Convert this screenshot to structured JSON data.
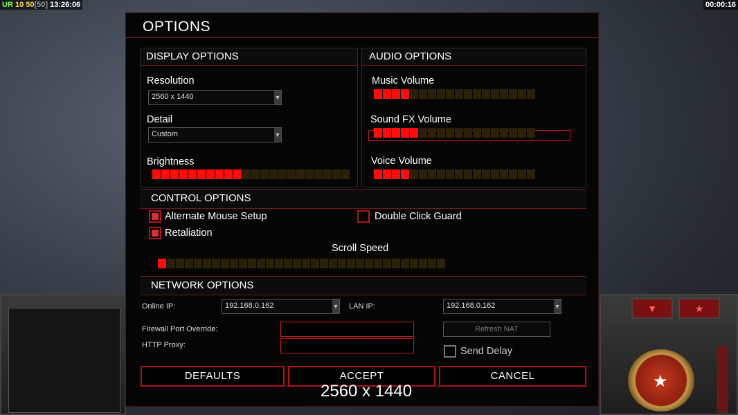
{
  "hud": {
    "left_ur": "UR",
    "left_num1": "10",
    "left_num2": "50",
    "left_bracket": "[50]",
    "left_time": "13:26:06",
    "right_time": "00:00:16"
  },
  "dialog": {
    "title": "OPTIONS"
  },
  "display": {
    "header": "DISPLAY OPTIONS",
    "resolution_label": "Resolution",
    "resolution_value": "2560 x 1440",
    "detail_label": "Detail",
    "detail_value": "Custom",
    "brightness_label": "Brightness",
    "brightness_level": 10,
    "brightness_segments": 22
  },
  "audio": {
    "header": "AUDIO OPTIONS",
    "music_label": "Music Volume",
    "music_level": 4,
    "sfx_label": "Sound FX Volume",
    "sfx_level": 5,
    "voice_label": "Voice Volume",
    "voice_level": 4,
    "segments": 18
  },
  "control": {
    "header": "CONTROL OPTIONS",
    "alt_mouse_label": "Alternate Mouse Setup",
    "alt_mouse_checked": true,
    "double_click_label": "Double Click Guard",
    "double_click_checked": false,
    "retaliation_label": "Retaliation",
    "retaliation_checked": true,
    "scroll_label": "Scroll Speed",
    "scroll_level": 1,
    "scroll_segments": 32
  },
  "network": {
    "header": "NETWORK OPTIONS",
    "online_ip_label": "Online IP:",
    "online_ip_value": "192.168.0.162",
    "lan_ip_label": "LAN IP:",
    "lan_ip_value": "192.168.0.162",
    "firewall_label": "Firewall Port Override:",
    "firewall_value": "",
    "proxy_label": "HTTP Proxy:",
    "proxy_value": "",
    "refresh_nat_label": "Refresh NAT",
    "send_delay_label": "Send Delay",
    "send_delay_checked": false
  },
  "buttons": {
    "defaults": "DEFAULTS",
    "accept": "ACCEPT",
    "cancel": "CANCEL"
  },
  "overlay": {
    "resolution_text": "2560 x 1440"
  },
  "colors": {
    "accent_red": "#ff0c0c",
    "border_red": "#b31212",
    "slider_off": "#2b2108"
  },
  "icons": {
    "dropdown": "triangle-down",
    "side_tab_left": "triangle-down",
    "side_tab_right": "star",
    "emblem": "star"
  }
}
